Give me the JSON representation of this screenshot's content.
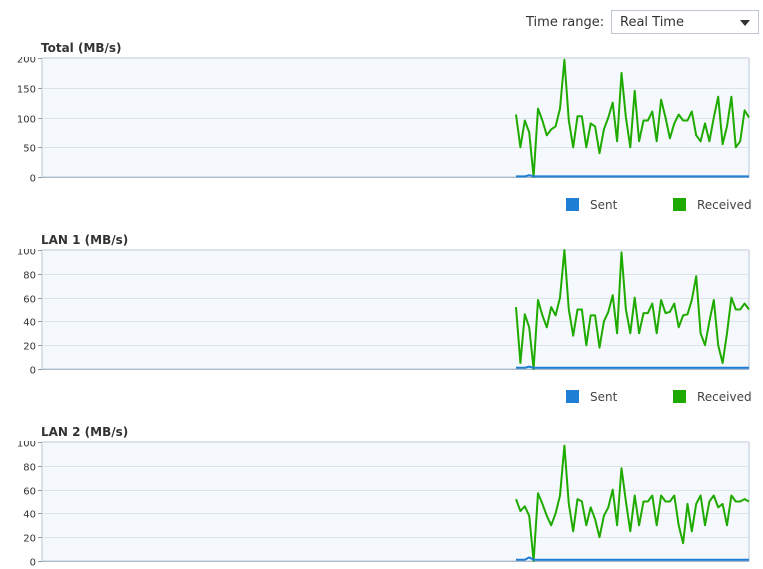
{
  "toolbar": {
    "time_range_label": "Time range:",
    "time_range_value": "Real Time"
  },
  "legend": {
    "sent": "Sent",
    "received": "Received"
  },
  "colors": {
    "sent": "#1e7fd4",
    "received": "#1faa00",
    "grid": "#dde3ea",
    "plot_bg": "#f5f9fd",
    "border": "#b8c6d6"
  },
  "chart_data": [
    {
      "type": "line",
      "title": "Total (MB/s)",
      "ylim": [
        0,
        200
      ],
      "yticks": [
        0,
        50,
        100,
        150,
        200
      ],
      "series": [
        {
          "name": "Received",
          "values": [
            105,
            50,
            95,
            75,
            0,
            115,
            95,
            70,
            80,
            85,
            115,
            197,
            95,
            50,
            102,
            102,
            50,
            90,
            85,
            40,
            80,
            100,
            125,
            60,
            175,
            100,
            50,
            145,
            60,
            95,
            95,
            110,
            60,
            130,
            100,
            65,
            90,
            105,
            95,
            95,
            110,
            70,
            60,
            90,
            60,
            100,
            135,
            55,
            85,
            135,
            50,
            60,
            112,
            100
          ]
        },
        {
          "name": "Sent",
          "values": [
            1,
            1,
            1,
            3,
            1,
            1,
            1,
            1,
            1,
            1,
            1,
            1,
            1,
            1,
            1,
            1,
            1,
            1,
            1,
            1,
            1,
            1,
            1,
            1,
            1,
            1,
            1,
            1,
            1,
            1,
            1,
            1,
            1,
            1,
            1,
            1,
            1,
            1,
            1,
            1,
            1,
            1,
            1,
            1,
            1,
            1,
            1,
            1,
            1,
            1,
            1,
            1,
            1,
            1
          ]
        }
      ]
    },
    {
      "type": "line",
      "title": "LAN 1 (MB/s)",
      "ylim": [
        0,
        100
      ],
      "yticks": [
        0,
        20,
        40,
        60,
        80,
        100
      ],
      "series": [
        {
          "name": "Received",
          "values": [
            52,
            5,
            46,
            35,
            0,
            58,
            45,
            35,
            52,
            45,
            60,
            100,
            50,
            28,
            50,
            50,
            20,
            45,
            45,
            18,
            40,
            48,
            62,
            30,
            98,
            50,
            30,
            60,
            30,
            47,
            47,
            55,
            30,
            58,
            47,
            48,
            55,
            35,
            45,
            46,
            58,
            78,
            30,
            20,
            40,
            58,
            20,
            5,
            30,
            60,
            50,
            50,
            55,
            50
          ]
        },
        {
          "name": "Sent",
          "values": [
            1,
            1,
            1,
            2,
            1,
            1,
            1,
            1,
            1,
            1,
            1,
            1,
            1,
            1,
            1,
            1,
            1,
            1,
            1,
            1,
            1,
            1,
            1,
            1,
            1,
            1,
            1,
            1,
            1,
            1,
            1,
            1,
            1,
            1,
            1,
            1,
            1,
            1,
            1,
            1,
            1,
            1,
            1,
            1,
            1,
            1,
            1,
            1,
            1,
            1,
            1,
            1,
            1,
            1
          ]
        }
      ]
    },
    {
      "type": "line",
      "title": "LAN 2 (MB/s)",
      "ylim": [
        0,
        100
      ],
      "yticks": [
        0,
        20,
        40,
        60,
        80,
        100
      ],
      "series": [
        {
          "name": "Received",
          "values": [
            52,
            42,
            46,
            38,
            0,
            57,
            48,
            38,
            30,
            40,
            55,
            97,
            48,
            25,
            52,
            50,
            30,
            45,
            35,
            20,
            38,
            45,
            60,
            30,
            78,
            50,
            25,
            55,
            30,
            50,
            50,
            55,
            30,
            55,
            50,
            50,
            55,
            30,
            15,
            48,
            25,
            48,
            55,
            30,
            50,
            55,
            45,
            48,
            30,
            55,
            50,
            50,
            52,
            50
          ]
        },
        {
          "name": "Sent",
          "values": [
            1,
            1,
            1,
            3,
            1,
            1,
            1,
            1,
            1,
            1,
            1,
            1,
            1,
            1,
            1,
            1,
            1,
            1,
            1,
            1,
            1,
            1,
            1,
            1,
            1,
            1,
            1,
            1,
            1,
            1,
            1,
            1,
            1,
            1,
            1,
            1,
            1,
            1,
            1,
            1,
            1,
            1,
            1,
            1,
            1,
            1,
            1,
            1,
            1,
            1,
            1,
            1,
            1,
            1
          ]
        }
      ]
    }
  ]
}
